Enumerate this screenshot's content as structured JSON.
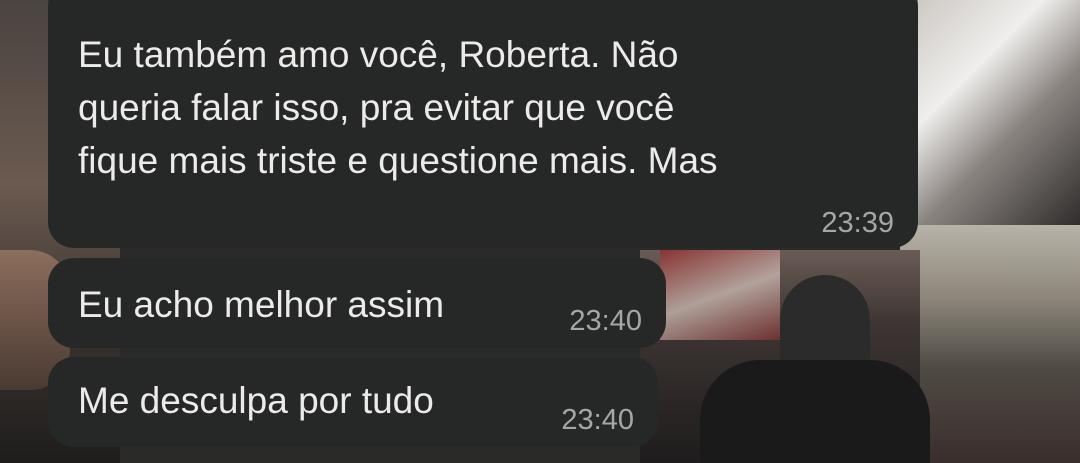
{
  "messages": [
    {
      "text": "Eu também amo você, Roberta. Não\nqueria falar isso, pra evitar que você\nfique mais triste e questione mais. Mas",
      "time": "23:39"
    },
    {
      "text": "Eu acho melhor assim",
      "time": "23:40"
    },
    {
      "text": "Me desculpa por tudo",
      "time": "23:40"
    }
  ],
  "colors": {
    "bubble": "#262827",
    "text": "#ecebe9",
    "timestamp": "#a6a7a5"
  }
}
